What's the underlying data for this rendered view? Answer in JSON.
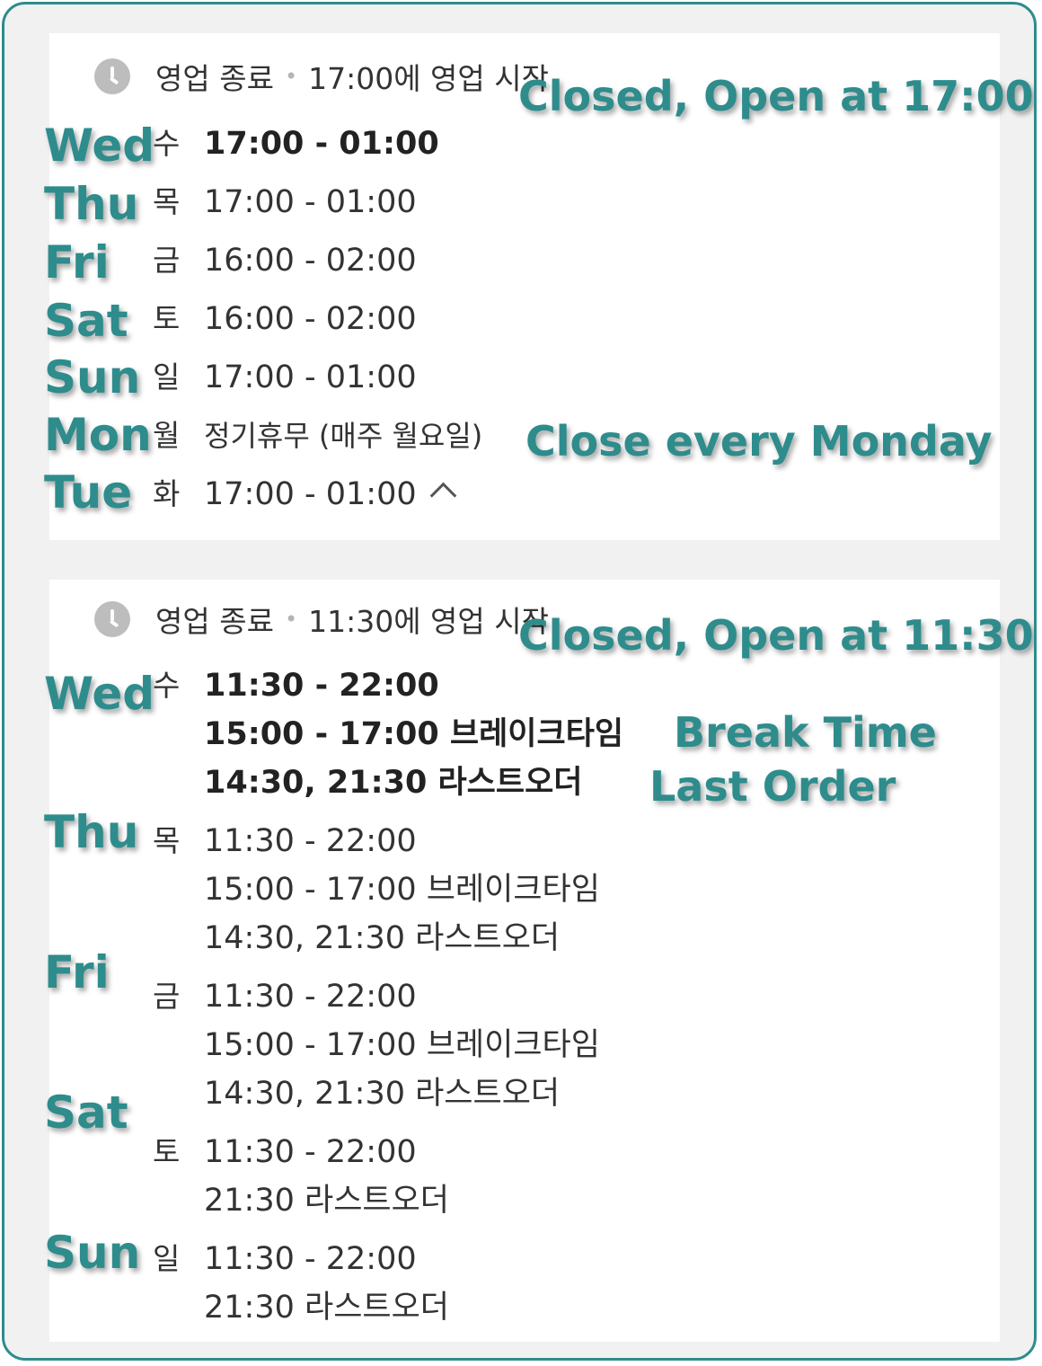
{
  "colors": {
    "accent": "#2e8c8c",
    "text": "#333333",
    "icon_gray": "#bdbdbd"
  },
  "panel1": {
    "status_label": "영업 종료",
    "status_detail": "17:00에 영업 시작",
    "rows": [
      {
        "day": "수",
        "line": "17:00 - 01:00"
      },
      {
        "day": "목",
        "line": "17:00 - 01:00"
      },
      {
        "day": "금",
        "line": "16:00 - 02:00"
      },
      {
        "day": "토",
        "line": "16:00 - 02:00"
      },
      {
        "day": "일",
        "line": "17:00 - 01:00"
      },
      {
        "day": "월",
        "line": "정기휴무 (매주 월요일)"
      },
      {
        "day": "화",
        "line": "17:00 - 01:00"
      }
    ],
    "annotations": {
      "status": "Closed, Open at 17:00",
      "monday": "Close every Monday",
      "days": [
        "Wed",
        "Thu",
        "Fri",
        "Sat",
        "Sun",
        "Mon",
        "Tue"
      ]
    }
  },
  "panel2": {
    "status_label": "영업 종료",
    "status_detail": "11:30에 영업 시작",
    "rows": [
      {
        "day": "수",
        "lines": [
          "11:30 - 22:00",
          "15:00 - 17:00 브레이크타임",
          "14:30, 21:30 라스트오더"
        ]
      },
      {
        "day": "목",
        "lines": [
          "11:30 - 22:00",
          "15:00 - 17:00 브레이크타임",
          "14:30, 21:30 라스트오더"
        ]
      },
      {
        "day": "금",
        "lines": [
          "11:30 - 22:00",
          "15:00 - 17:00 브레이크타임",
          "14:30, 21:30 라스트오더"
        ]
      },
      {
        "day": "토",
        "lines": [
          "11:30 - 22:00",
          "21:30 라스트오더"
        ]
      },
      {
        "day": "일",
        "lines": [
          "11:30 - 22:00",
          "21:30 라스트오더"
        ]
      }
    ],
    "annotations": {
      "status": "Closed, Open at 11:30",
      "break_time": "Break Time",
      "last_order": "Last Order",
      "days": [
        "Wed",
        "Thu",
        "Fri",
        "Sat",
        "Sun"
      ]
    }
  },
  "icons": {
    "status": "clock-icon",
    "collapse": "chevron-up-icon"
  }
}
